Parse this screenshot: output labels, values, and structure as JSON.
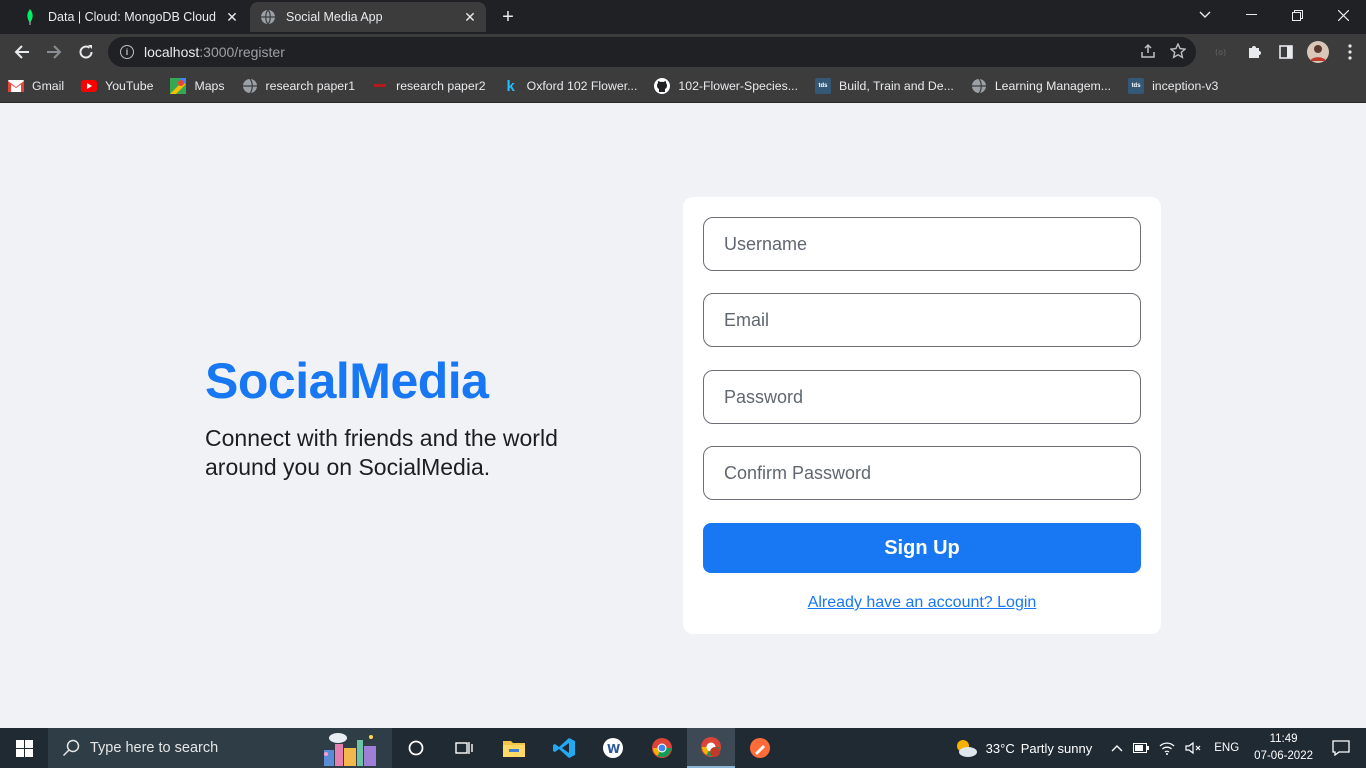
{
  "browser": {
    "tabs": [
      {
        "title": "Data | Cloud: MongoDB Cloud",
        "favicon": "mongodb-leaf-icon",
        "active": false
      },
      {
        "title": "Social Media App",
        "favicon": "globe-icon",
        "active": true
      }
    ],
    "url": {
      "host": "localhost",
      "path": ":3000/register"
    },
    "bookmarks": [
      {
        "label": "Gmail",
        "icon": "gmail-icon"
      },
      {
        "label": "YouTube",
        "icon": "youtube-icon"
      },
      {
        "label": "Maps",
        "icon": "maps-icon"
      },
      {
        "label": "research paper1",
        "icon": "globe-icon"
      },
      {
        "label": "research paper2",
        "icon": "red-dash-icon"
      },
      {
        "label": "Oxford 102 Flower...",
        "icon": "kaggle-icon"
      },
      {
        "label": "102-Flower-Species...",
        "icon": "github-icon"
      },
      {
        "label": "Build, Train and De...",
        "icon": "tds-icon"
      },
      {
        "label": "Learning Managem...",
        "icon": "globe-icon"
      },
      {
        "label": "inception-v3",
        "icon": "tds-icon"
      }
    ]
  },
  "page": {
    "brand": "SocialMedia",
    "tagline": "Connect with friends and the world around you on SocialMedia.",
    "form": {
      "username_placeholder": "Username",
      "email_placeholder": "Email",
      "password_placeholder": "Password",
      "confirm_placeholder": "Confirm Password",
      "signup_label": "Sign Up",
      "login_link": "Already have an account? Login"
    }
  },
  "taskbar": {
    "search_placeholder": "Type here to search",
    "weather": {
      "temp": "33°C",
      "desc": "Partly sunny"
    },
    "language": "ENG",
    "time": "11:49",
    "date": "07-06-2022"
  },
  "colors": {
    "accent": "#1877f2",
    "page_bg": "#f0f2f5",
    "chrome_dark": "#202124",
    "taskbar": "#1f2a33"
  }
}
